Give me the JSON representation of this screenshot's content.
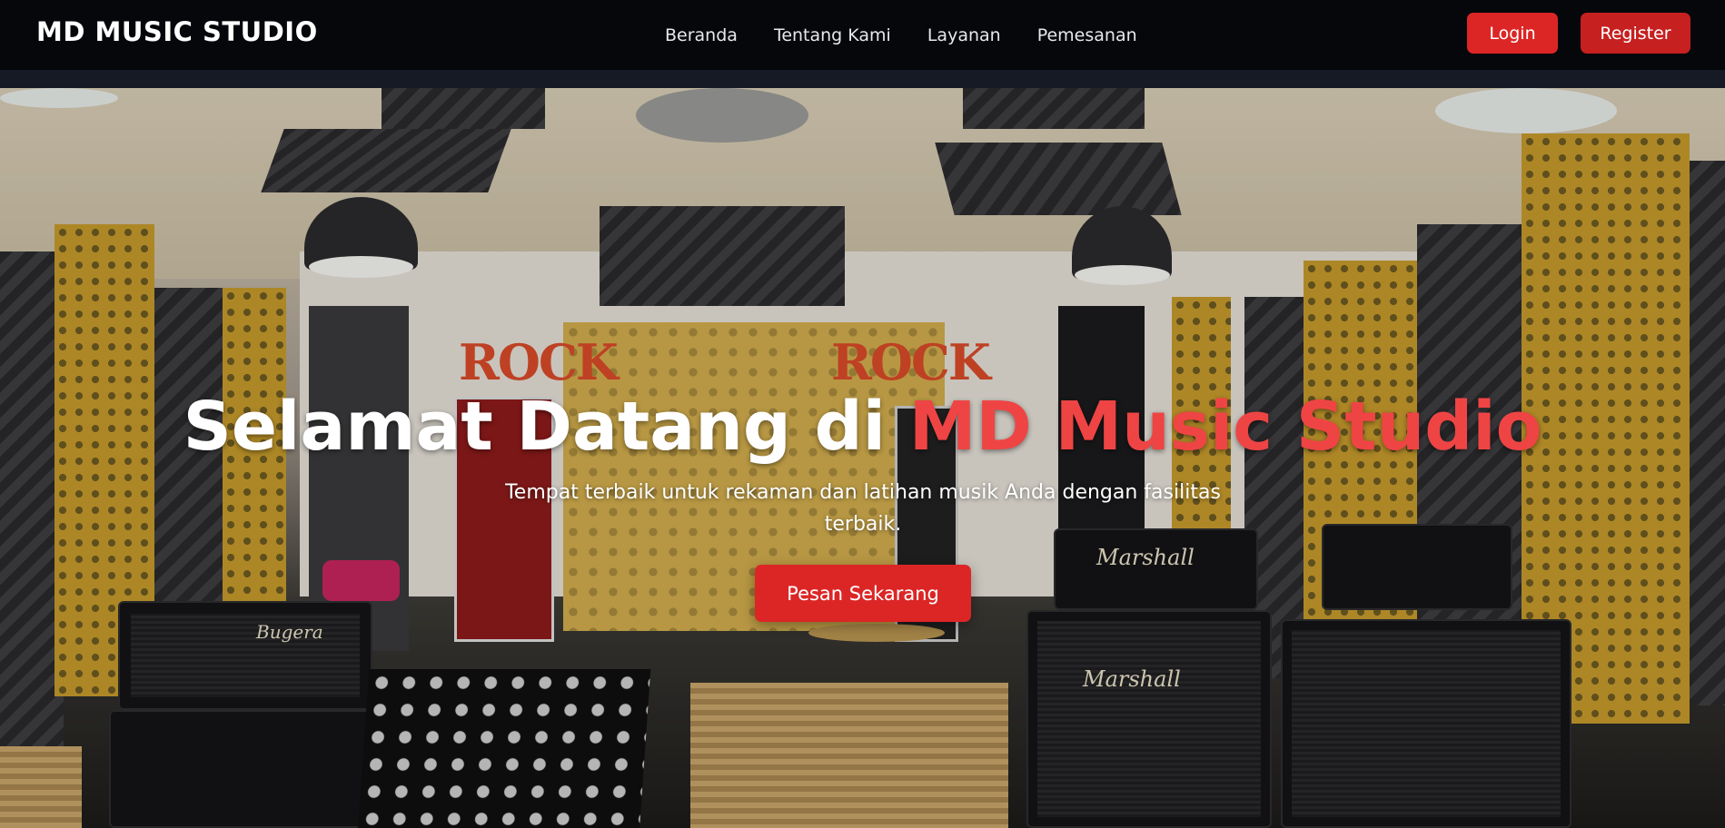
{
  "navbar": {
    "brand": "MD MUSIC STUDIO",
    "links": [
      {
        "label": "Beranda"
      },
      {
        "label": "Tentang Kami"
      },
      {
        "label": "Layanan"
      },
      {
        "label": "Pemesanan"
      }
    ],
    "login_label": "Login",
    "register_label": "Register"
  },
  "hero": {
    "title_prefix": "Selamat Datang di ",
    "title_accent": "MD Music Studio",
    "subtitle": "Tempat terbaik untuk rekaman dan latihan musik Anda dengan fasilitas terbaik.",
    "cta_label": "Pesan Sekarang",
    "background_signs": [
      "ROCK",
      "ROCK"
    ],
    "amp_brands": [
      "Marshall",
      "Marshall",
      "Bugera"
    ]
  },
  "colors": {
    "navbar_bg": "#05070b",
    "accent_red": "#dc2626",
    "title_accent": "#ef4444",
    "text_white": "#ffffff"
  }
}
